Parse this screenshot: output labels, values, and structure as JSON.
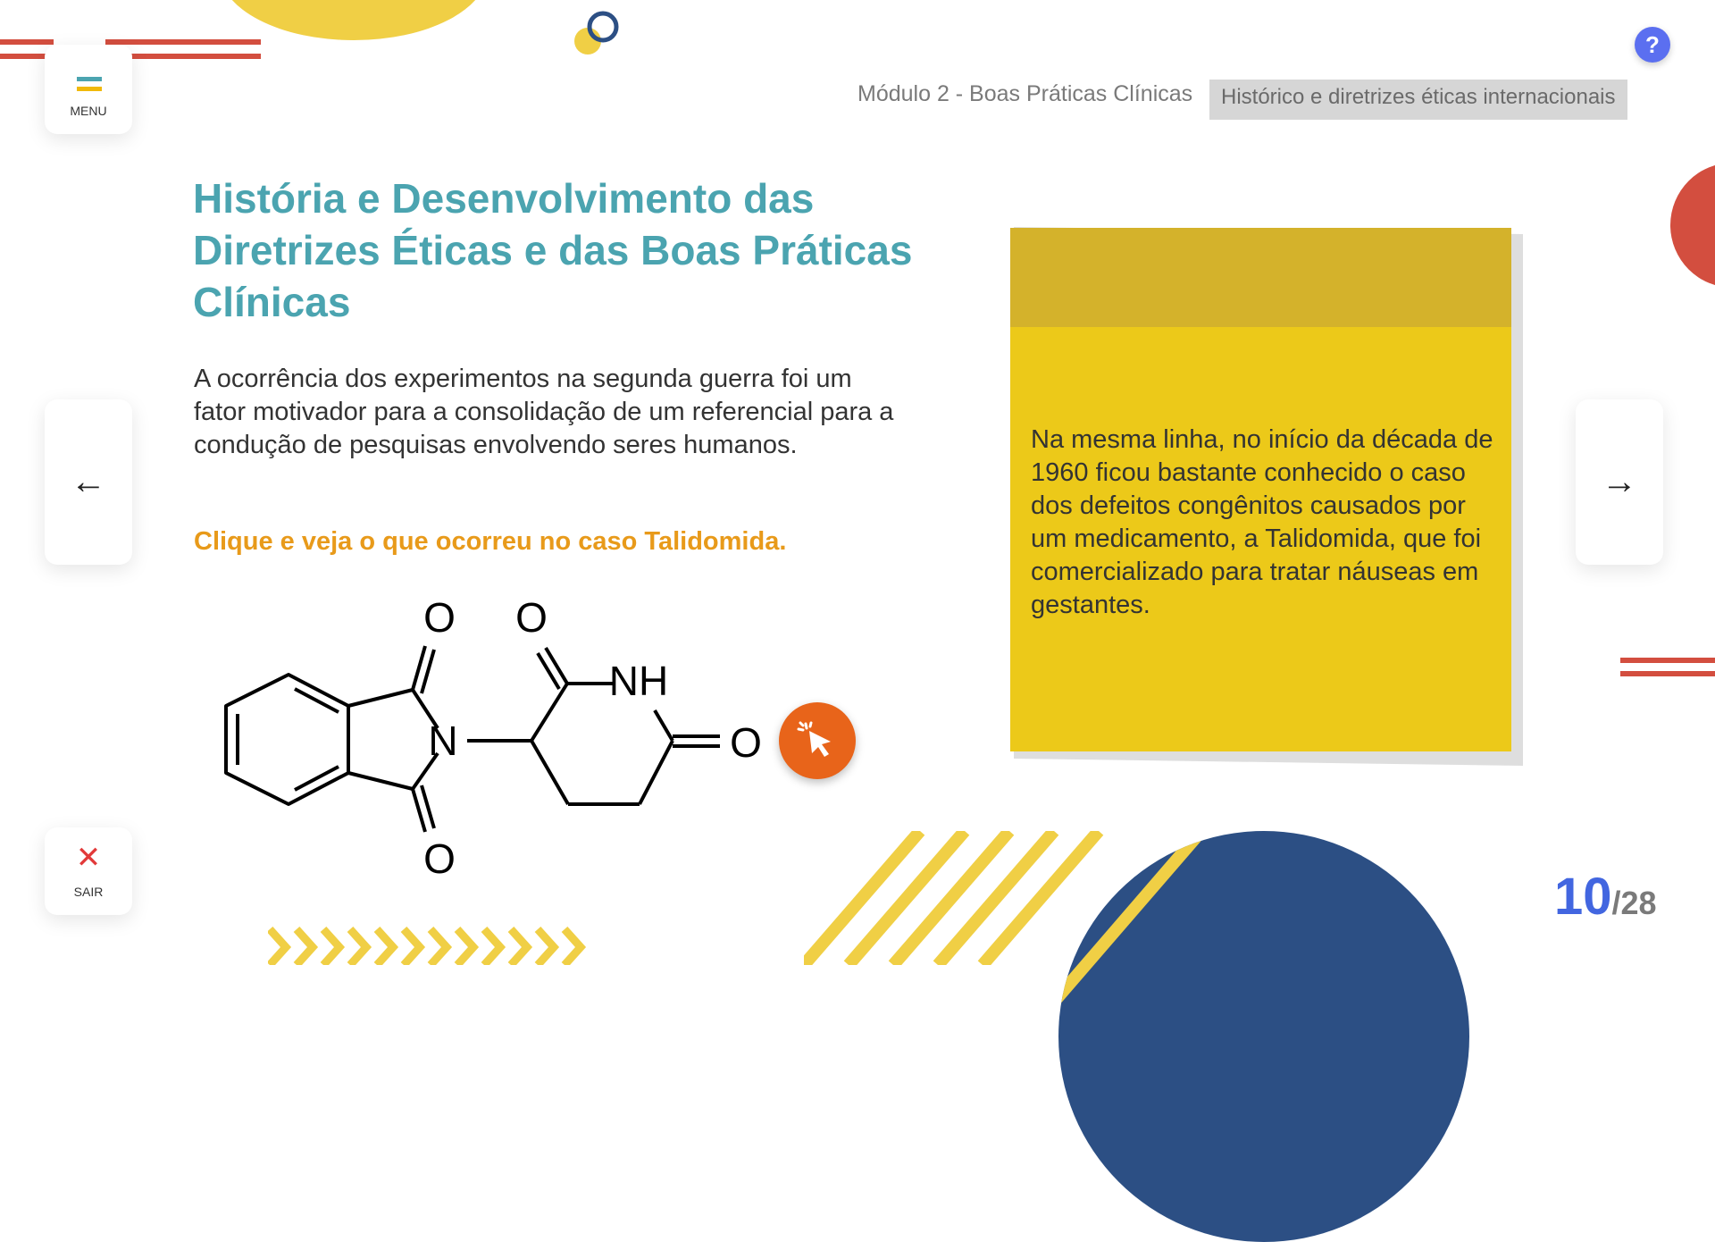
{
  "menu": {
    "label": "MENU"
  },
  "exit": {
    "label": "SAIR",
    "icon": "close-icon"
  },
  "help": {
    "label": "?"
  },
  "breadcrumb": {
    "module": "Módulo 2 - Boas Práticas Clínicas",
    "topic": "Histórico e diretrizes éticas internacionais"
  },
  "content": {
    "title": "História e Desenvolvimento das Diretrizes Éticas e das Boas Práticas Clínicas",
    "body": "A ocorrência dos experimentos na segunda guerra foi um fator motivador para a consolidação de um referencial para a condução de pesquisas envolvendo seres humanos.",
    "cta": "Clique e veja o que ocorreu no caso Talidomida."
  },
  "molecule": {
    "o1": "O",
    "o2": "O",
    "o3": "O",
    "o4": "O",
    "n": "N",
    "nh": "NH"
  },
  "note": {
    "text": "Na mesma linha, no início da década de 1960 ficou bastante conhecido o caso dos defeitos congênitos causados por um medicamento, a Talidomida, que foi comercializado para tratar náuseas em gestantes."
  },
  "navigation": {
    "prev_icon": "←",
    "next_icon": "→"
  },
  "pagination": {
    "current": "10",
    "total": "/28"
  },
  "colors": {
    "title": "#4ba4b0",
    "cta": "#e89a1a",
    "note": "#ecc919",
    "note_header": "#d4b22b",
    "click_button": "#e8641a",
    "page_current": "#4266e0",
    "help": "#5b6ff0"
  }
}
